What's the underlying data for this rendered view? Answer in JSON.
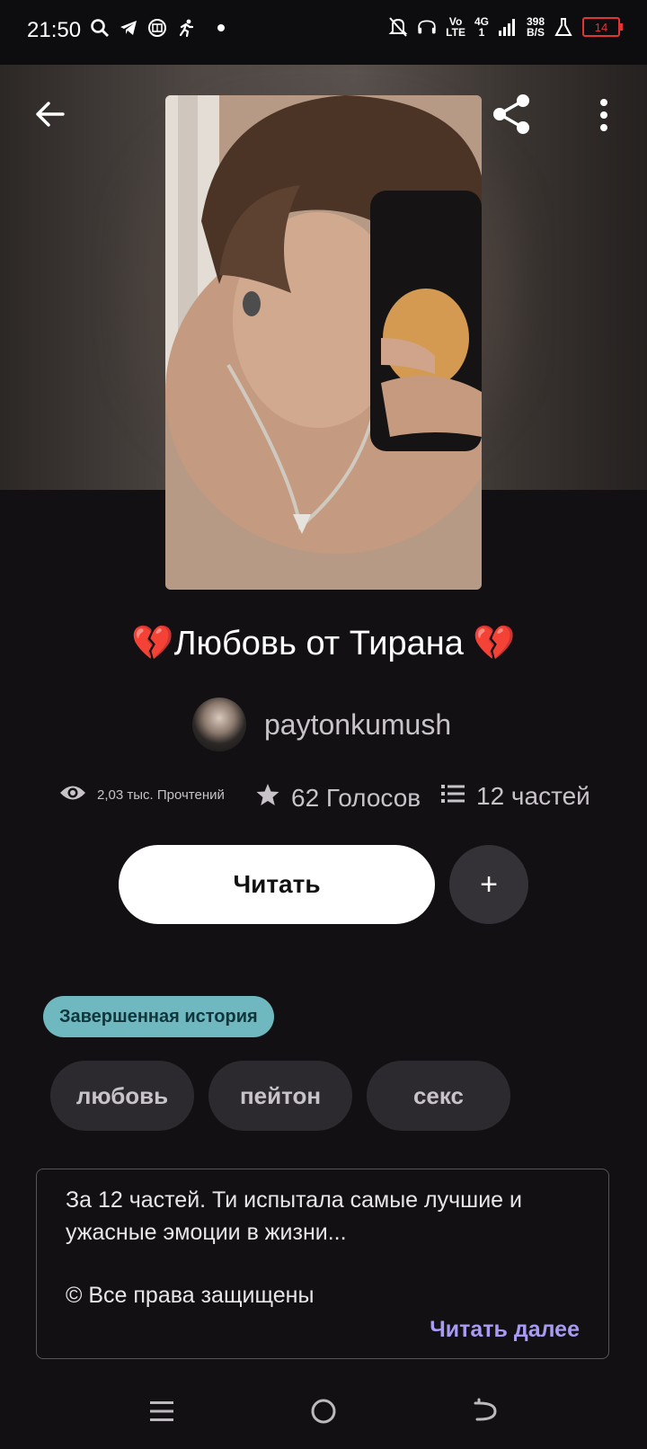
{
  "status_bar": {
    "time": "21:50",
    "left_icons": [
      "search-icon",
      "telegram-icon",
      "app-icon",
      "running-icon"
    ],
    "right_icons": [
      "mute-icon",
      "headphones-icon",
      "volte-icon",
      "signal-icon"
    ],
    "volte_top": "Vo",
    "volte_bottom": "LTE",
    "network": "4G",
    "network_sub": "1",
    "speed_value": "398",
    "speed_unit": "B/S",
    "battery": "14"
  },
  "story": {
    "title": "💔Любовь от Тирана 💔",
    "author": "paytonkumush",
    "reads": "2,03 тыс. Прочтений",
    "votes": "62 Голосов",
    "parts": "12 частей",
    "read_button": "Читать",
    "add_button": "+",
    "completed_label": "Завершенная история",
    "tags": [
      "любовь",
      "пейтон",
      "секс"
    ],
    "description": "За 12 частей. Ти испытала самые лучшие и ужасные эмоции в жизни...",
    "copyright": "© Все права защищены",
    "read_more": "Читать далее"
  },
  "colors": {
    "background": "#121013",
    "completed_badge": "#6fb8c0",
    "read_more": "#a99bf3",
    "battery_low": "#e03535"
  }
}
